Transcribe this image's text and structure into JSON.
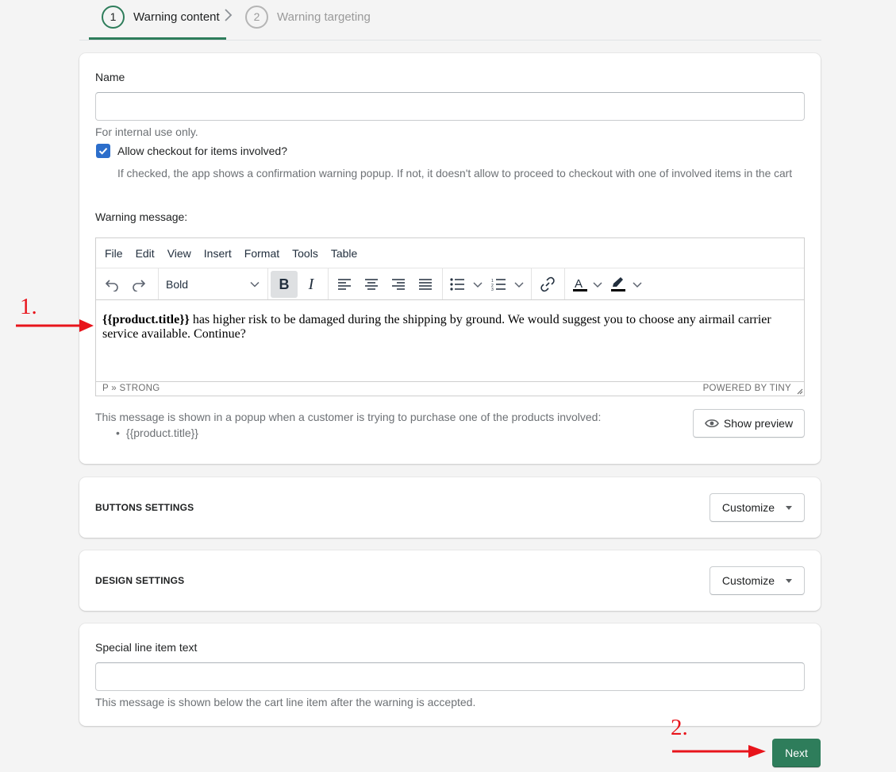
{
  "stepper": {
    "steps": [
      {
        "number": "1",
        "label": "Warning content"
      },
      {
        "number": "2",
        "label": "Warning targeting"
      }
    ]
  },
  "main_card": {
    "name_label": "Name",
    "name_value": "",
    "name_help": "For internal use only.",
    "checkbox_label": "Allow checkout for items involved?",
    "checkbox_checked": true,
    "checkbox_help": "If checked, the app shows a confirmation warning popup. If not, it doesn't allow to proceed to checkout with one of involved items in the cart",
    "warning_label": "Warning message:",
    "editor": {
      "menu": [
        "File",
        "Edit",
        "View",
        "Insert",
        "Format",
        "Tools",
        "Table"
      ],
      "format_select": "Bold",
      "content_bold": "{{product.title}}",
      "content_rest": " has higher risk to be damaged during the shipping by ground. We would suggest you to choose any airmail carrier service available. Continue?",
      "status_path": "P » STRONG",
      "status_brand": "POWERED BY TINY"
    },
    "message_help": "This message is shown in a popup when a customer is trying to purchase one of the products involved:",
    "message_variables": [
      "{{product.title}}"
    ],
    "preview_button": "Show preview"
  },
  "buttons_settings": {
    "title": "BUTTONS SETTINGS",
    "button": "Customize"
  },
  "design_settings": {
    "title": "DESIGN SETTINGS",
    "button": "Customize"
  },
  "special_line": {
    "label": "Special line item text",
    "value": "",
    "help": "This message is shown below the cart line item after the warning is accepted."
  },
  "next_button": "Next",
  "annotations": {
    "first": "1.",
    "second": "2.",
    "color": "#e8141b"
  },
  "colors": {
    "accent": "#2e7d5b",
    "checkbox": "#2c6ecb"
  }
}
